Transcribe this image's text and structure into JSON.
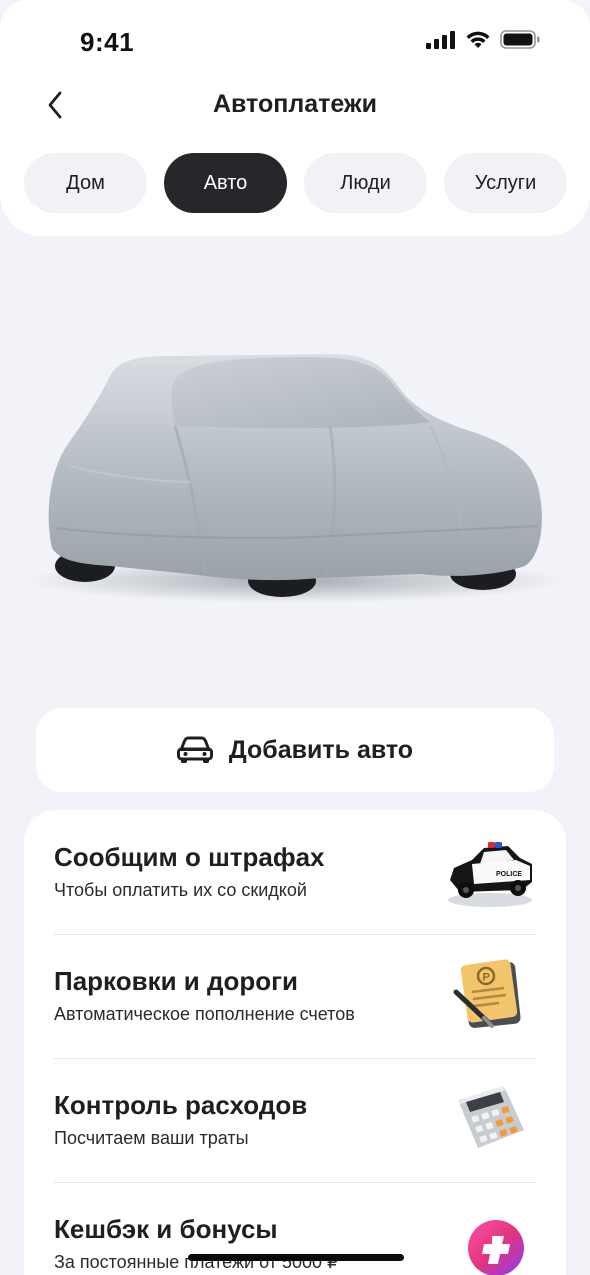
{
  "status": {
    "time": "9:41"
  },
  "header": {
    "title": "Автоплатежи"
  },
  "tabs": [
    {
      "label": "Дом",
      "active": false
    },
    {
      "label": "Авто",
      "active": true
    },
    {
      "label": "Люди",
      "active": false
    },
    {
      "label": "Услуги",
      "active": false
    }
  ],
  "add_car": {
    "label": "Добавить авто",
    "icon": "car-icon"
  },
  "features": [
    {
      "title": "Сообщим о штрафах",
      "subtitle": "Чтобы оплатить их со скидкой",
      "icon": "police-car-icon"
    },
    {
      "title": "Парковки и дороги",
      "subtitle": "Автоматическое пополнение счетов",
      "icon": "parking-ticket-icon"
    },
    {
      "title": "Контроль расходов",
      "subtitle": "Посчитаем ваши траты",
      "icon": "calculator-icon"
    },
    {
      "title": "Кешбэк и бонусы",
      "subtitle": "За постоянные платежи от 5000 ₽",
      "icon": "cashback-plus-icon"
    }
  ],
  "colors": {
    "active_tab": "#26272b",
    "background": "#f1f3f8",
    "card": "#ffffff"
  }
}
